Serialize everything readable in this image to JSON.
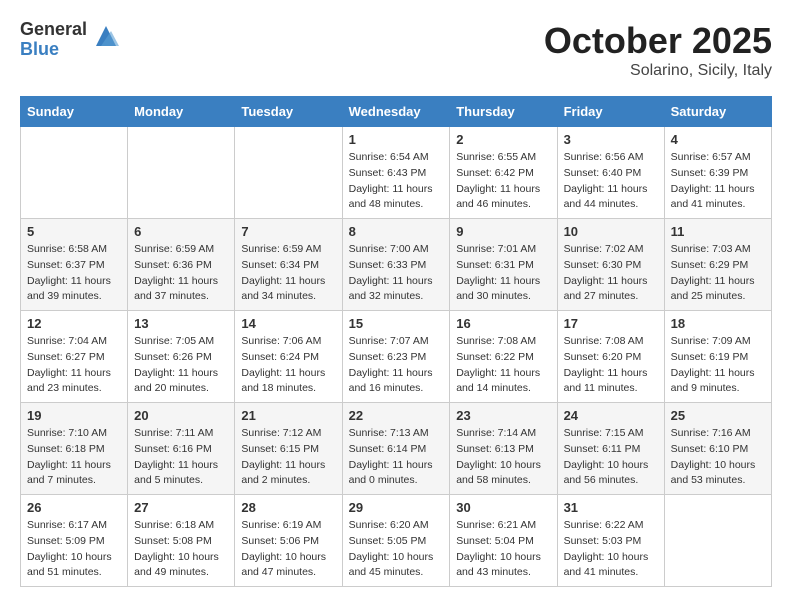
{
  "logo": {
    "general": "General",
    "blue": "Blue"
  },
  "title": "October 2025",
  "subtitle": "Solarino, Sicily, Italy",
  "weekdays": [
    "Sunday",
    "Monday",
    "Tuesday",
    "Wednesday",
    "Thursday",
    "Friday",
    "Saturday"
  ],
  "weeks": [
    [
      {
        "day": "",
        "info": ""
      },
      {
        "day": "",
        "info": ""
      },
      {
        "day": "",
        "info": ""
      },
      {
        "day": "1",
        "info": "Sunrise: 6:54 AM\nSunset: 6:43 PM\nDaylight: 11 hours\nand 48 minutes."
      },
      {
        "day": "2",
        "info": "Sunrise: 6:55 AM\nSunset: 6:42 PM\nDaylight: 11 hours\nand 46 minutes."
      },
      {
        "day": "3",
        "info": "Sunrise: 6:56 AM\nSunset: 6:40 PM\nDaylight: 11 hours\nand 44 minutes."
      },
      {
        "day": "4",
        "info": "Sunrise: 6:57 AM\nSunset: 6:39 PM\nDaylight: 11 hours\nand 41 minutes."
      }
    ],
    [
      {
        "day": "5",
        "info": "Sunrise: 6:58 AM\nSunset: 6:37 PM\nDaylight: 11 hours\nand 39 minutes."
      },
      {
        "day": "6",
        "info": "Sunrise: 6:59 AM\nSunset: 6:36 PM\nDaylight: 11 hours\nand 37 minutes."
      },
      {
        "day": "7",
        "info": "Sunrise: 6:59 AM\nSunset: 6:34 PM\nDaylight: 11 hours\nand 34 minutes."
      },
      {
        "day": "8",
        "info": "Sunrise: 7:00 AM\nSunset: 6:33 PM\nDaylight: 11 hours\nand 32 minutes."
      },
      {
        "day": "9",
        "info": "Sunrise: 7:01 AM\nSunset: 6:31 PM\nDaylight: 11 hours\nand 30 minutes."
      },
      {
        "day": "10",
        "info": "Sunrise: 7:02 AM\nSunset: 6:30 PM\nDaylight: 11 hours\nand 27 minutes."
      },
      {
        "day": "11",
        "info": "Sunrise: 7:03 AM\nSunset: 6:29 PM\nDaylight: 11 hours\nand 25 minutes."
      }
    ],
    [
      {
        "day": "12",
        "info": "Sunrise: 7:04 AM\nSunset: 6:27 PM\nDaylight: 11 hours\nand 23 minutes."
      },
      {
        "day": "13",
        "info": "Sunrise: 7:05 AM\nSunset: 6:26 PM\nDaylight: 11 hours\nand 20 minutes."
      },
      {
        "day": "14",
        "info": "Sunrise: 7:06 AM\nSunset: 6:24 PM\nDaylight: 11 hours\nand 18 minutes."
      },
      {
        "day": "15",
        "info": "Sunrise: 7:07 AM\nSunset: 6:23 PM\nDaylight: 11 hours\nand 16 minutes."
      },
      {
        "day": "16",
        "info": "Sunrise: 7:08 AM\nSunset: 6:22 PM\nDaylight: 11 hours\nand 14 minutes."
      },
      {
        "day": "17",
        "info": "Sunrise: 7:08 AM\nSunset: 6:20 PM\nDaylight: 11 hours\nand 11 minutes."
      },
      {
        "day": "18",
        "info": "Sunrise: 7:09 AM\nSunset: 6:19 PM\nDaylight: 11 hours\nand 9 minutes."
      }
    ],
    [
      {
        "day": "19",
        "info": "Sunrise: 7:10 AM\nSunset: 6:18 PM\nDaylight: 11 hours\nand 7 minutes."
      },
      {
        "day": "20",
        "info": "Sunrise: 7:11 AM\nSunset: 6:16 PM\nDaylight: 11 hours\nand 5 minutes."
      },
      {
        "day": "21",
        "info": "Sunrise: 7:12 AM\nSunset: 6:15 PM\nDaylight: 11 hours\nand 2 minutes."
      },
      {
        "day": "22",
        "info": "Sunrise: 7:13 AM\nSunset: 6:14 PM\nDaylight: 11 hours\nand 0 minutes."
      },
      {
        "day": "23",
        "info": "Sunrise: 7:14 AM\nSunset: 6:13 PM\nDaylight: 10 hours\nand 58 minutes."
      },
      {
        "day": "24",
        "info": "Sunrise: 7:15 AM\nSunset: 6:11 PM\nDaylight: 10 hours\nand 56 minutes."
      },
      {
        "day": "25",
        "info": "Sunrise: 7:16 AM\nSunset: 6:10 PM\nDaylight: 10 hours\nand 53 minutes."
      }
    ],
    [
      {
        "day": "26",
        "info": "Sunrise: 6:17 AM\nSunset: 5:09 PM\nDaylight: 10 hours\nand 51 minutes."
      },
      {
        "day": "27",
        "info": "Sunrise: 6:18 AM\nSunset: 5:08 PM\nDaylight: 10 hours\nand 49 minutes."
      },
      {
        "day": "28",
        "info": "Sunrise: 6:19 AM\nSunset: 5:06 PM\nDaylight: 10 hours\nand 47 minutes."
      },
      {
        "day": "29",
        "info": "Sunrise: 6:20 AM\nSunset: 5:05 PM\nDaylight: 10 hours\nand 45 minutes."
      },
      {
        "day": "30",
        "info": "Sunrise: 6:21 AM\nSunset: 5:04 PM\nDaylight: 10 hours\nand 43 minutes."
      },
      {
        "day": "31",
        "info": "Sunrise: 6:22 AM\nSunset: 5:03 PM\nDaylight: 10 hours\nand 41 minutes."
      },
      {
        "day": "",
        "info": ""
      }
    ]
  ]
}
